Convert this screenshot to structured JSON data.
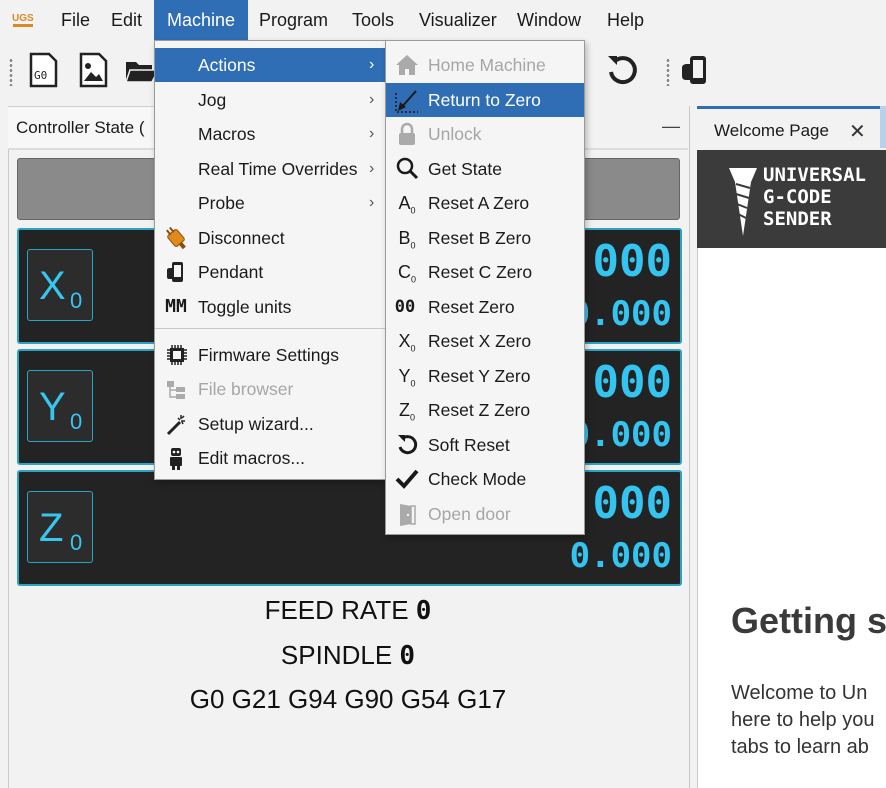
{
  "menubar": {
    "logo_text": "UGS",
    "items": [
      "File",
      "Edit",
      "Machine",
      "Program",
      "Tools",
      "Visualizer",
      "Window",
      "Help"
    ],
    "active": "Machine"
  },
  "toolbar": {
    "g0_label": "G0"
  },
  "controller_state": {
    "title": "Controller State (",
    "axes": [
      {
        "letter": "X",
        "sub": "0",
        "work": ".000",
        "machine": "0.000"
      },
      {
        "letter": "Y",
        "sub": "0",
        "work": ".000",
        "machine": "0.000"
      },
      {
        "letter": "Z",
        "sub": "0",
        "work": ".000",
        "machine": "0.000"
      }
    ],
    "feed_label": "FEED RATE",
    "feed_value": "0",
    "spindle_label": "SPINDLE",
    "spindle_value": "0",
    "gcode_state": "G0 G21 G94 G90 G54 G17"
  },
  "welcome": {
    "tab_label": "Welcome Page",
    "logo_lines": [
      "UNIVERSAL",
      "G-CODE",
      "SENDER"
    ],
    "heading": "Getting s",
    "lines": [
      "Welcome to Un",
      "here to help you",
      "tabs to learn ab"
    ]
  },
  "machine_menu": {
    "items": [
      {
        "label": "Actions",
        "submenu": true,
        "icon": "",
        "highlighted": true
      },
      {
        "label": "Jog",
        "submenu": true,
        "icon": ""
      },
      {
        "label": "Macros",
        "submenu": true,
        "icon": ""
      },
      {
        "label": "Real Time Overrides",
        "submenu": true,
        "icon": ""
      },
      {
        "label": "Probe",
        "submenu": true,
        "icon": ""
      },
      {
        "label": "Disconnect",
        "icon": "plug-icon"
      },
      {
        "label": "Pendant",
        "icon": "phone-icon"
      },
      {
        "label": "Toggle units",
        "icon": "units-icon",
        "icon_text": "MM"
      },
      {
        "label": "Firmware Settings",
        "icon": "chip-icon"
      },
      {
        "label": "File browser",
        "icon": "file-browser-icon",
        "disabled": true
      },
      {
        "label": "Setup wizard...",
        "icon": "wand-icon"
      },
      {
        "label": "Edit macros...",
        "icon": "robot-icon"
      }
    ]
  },
  "actions_menu": {
    "items": [
      {
        "label": "Home Machine",
        "icon": "home-icon",
        "disabled": true
      },
      {
        "label": "Return to Zero",
        "icon": "return-to-zero-icon",
        "highlighted": true
      },
      {
        "label": "Unlock",
        "icon": "lock-icon",
        "disabled": true
      },
      {
        "label": "Get State",
        "icon": "search-icon"
      },
      {
        "label": "Reset A Zero",
        "icon": "axis-a-icon",
        "glyph": "A"
      },
      {
        "label": "Reset B Zero",
        "icon": "axis-b-icon",
        "glyph": "B"
      },
      {
        "label": "Reset C Zero",
        "icon": "axis-c-icon",
        "glyph": "C"
      },
      {
        "label": "Reset Zero",
        "icon": "reset-zero-icon",
        "glyph": "00"
      },
      {
        "label": "Reset X Zero",
        "icon": "axis-x-icon",
        "glyph": "X"
      },
      {
        "label": "Reset Y Zero",
        "icon": "axis-y-icon",
        "glyph": "Y"
      },
      {
        "label": "Reset Z Zero",
        "icon": "axis-z-icon",
        "glyph": "Z"
      },
      {
        "label": "Soft Reset",
        "icon": "soft-reset-icon"
      },
      {
        "label": "Check Mode",
        "icon": "checkmark-icon"
      },
      {
        "label": "Open door",
        "icon": "door-icon",
        "disabled": true
      }
    ]
  },
  "colors": {
    "accent": "#2f6db5",
    "dro_digit": "#33c4f0",
    "dro_background": "#232323",
    "disabled_text": "#a6a6a6"
  }
}
